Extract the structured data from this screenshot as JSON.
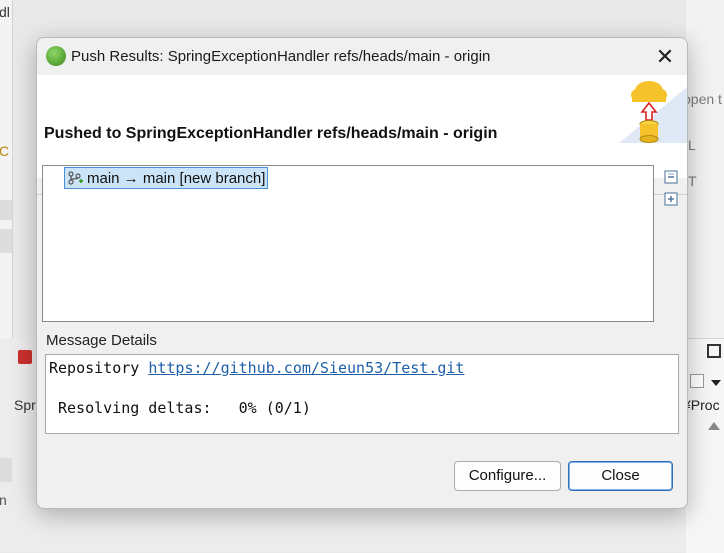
{
  "window": {
    "title": "Push Results: SpringExceptionHandler refs/heads/main - origin",
    "close_symbol": "✕"
  },
  "header": {
    "title": "Pushed to SpringExceptionHandler refs/heads/main - origin",
    "image_icon": "cloud-upload-repository-icon"
  },
  "results": {
    "items": [
      {
        "label": "main → main [new branch]",
        "icon": "branch-add-icon",
        "selected": true
      }
    ],
    "side_buttons": [
      "collapse-all-icon",
      "expand-all-icon"
    ]
  },
  "details": {
    "label": "Message Details",
    "repository_label": "Repository",
    "repository_url": "https://github.com/Sieun53/Test.git",
    "progress_text": "Resolving deltas:   0% (0/1)"
  },
  "buttons": {
    "configure": "Configure...",
    "close": "Close"
  },
  "background": {
    "left_fragments": [
      "dl",
      "C",
      "Spr",
      "n"
    ],
    "right_fragments": [
      "open t",
      "L",
      "T",
      "¥Proc"
    ]
  },
  "colors": {
    "selection_bg": "#cce4f7",
    "selection_border": "#4a90d9",
    "link": "#1f5fa8"
  }
}
